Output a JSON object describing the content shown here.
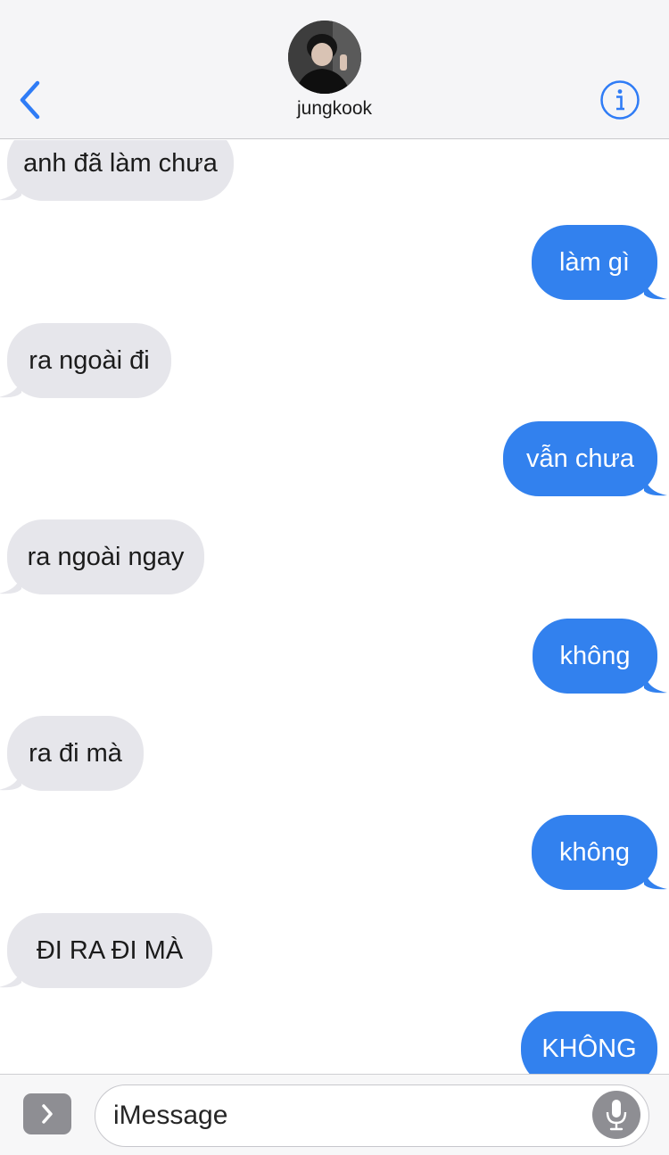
{
  "header": {
    "contact_name": "jungkook",
    "back_icon": "chevron-left-icon",
    "info_icon": "info-circle-icon"
  },
  "messages": [
    {
      "from": "them",
      "text": "anh đã làm chưa"
    },
    {
      "from": "me",
      "text": "làm gì"
    },
    {
      "from": "them",
      "text": "ra ngoài đi"
    },
    {
      "from": "me",
      "text": "vẫn chưa"
    },
    {
      "from": "them",
      "text": "ra ngoài ngay"
    },
    {
      "from": "me",
      "text": "không"
    },
    {
      "from": "them",
      "text": "ra đi mà"
    },
    {
      "from": "me",
      "text": "không"
    },
    {
      "from": "them",
      "text": "ĐI RA ĐI MÀ"
    },
    {
      "from": "me",
      "text": "KHÔNG"
    }
  ],
  "input": {
    "placeholder": "iMessage",
    "apps_icon": "chevron-right-icon",
    "mic_icon": "microphone-icon"
  },
  "colors": {
    "accent": "#3281ee",
    "received_bubble": "#e6e6eb",
    "header_background": "#f5f5f7"
  }
}
